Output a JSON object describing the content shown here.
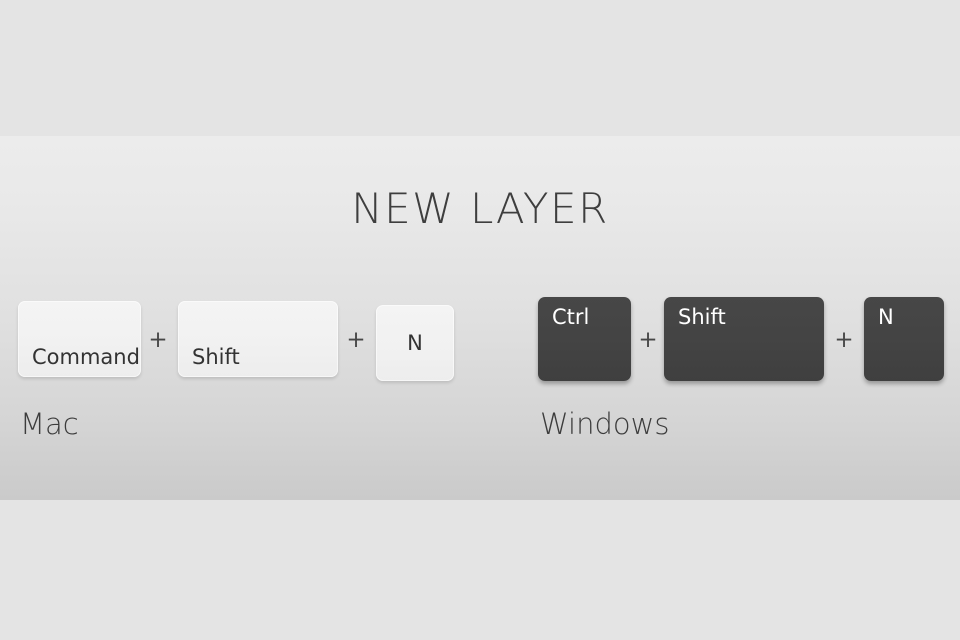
{
  "title": "NEW LAYER",
  "separator": "+",
  "groups": [
    {
      "platform": "Mac",
      "keys": [
        {
          "label": "Command"
        },
        {
          "label": "Shift"
        },
        {
          "label": "N"
        }
      ]
    },
    {
      "platform": "Windows",
      "keys": [
        {
          "label": "Ctrl"
        },
        {
          "label": "Shift"
        },
        {
          "label": "N"
        }
      ]
    }
  ],
  "colors": {
    "band_outer": "#e4e4e4",
    "band_middle_top": "#ececec",
    "band_middle_bottom": "#cacaca",
    "title_text": "#3e3e3e",
    "key_light_bg": "#f2f2f2",
    "key_light_text": "#333333",
    "key_dark_bg": "#434343",
    "key_dark_text": "#ffffff",
    "plus_text": "#474747",
    "platform_label_text": "#3c3c3c"
  }
}
